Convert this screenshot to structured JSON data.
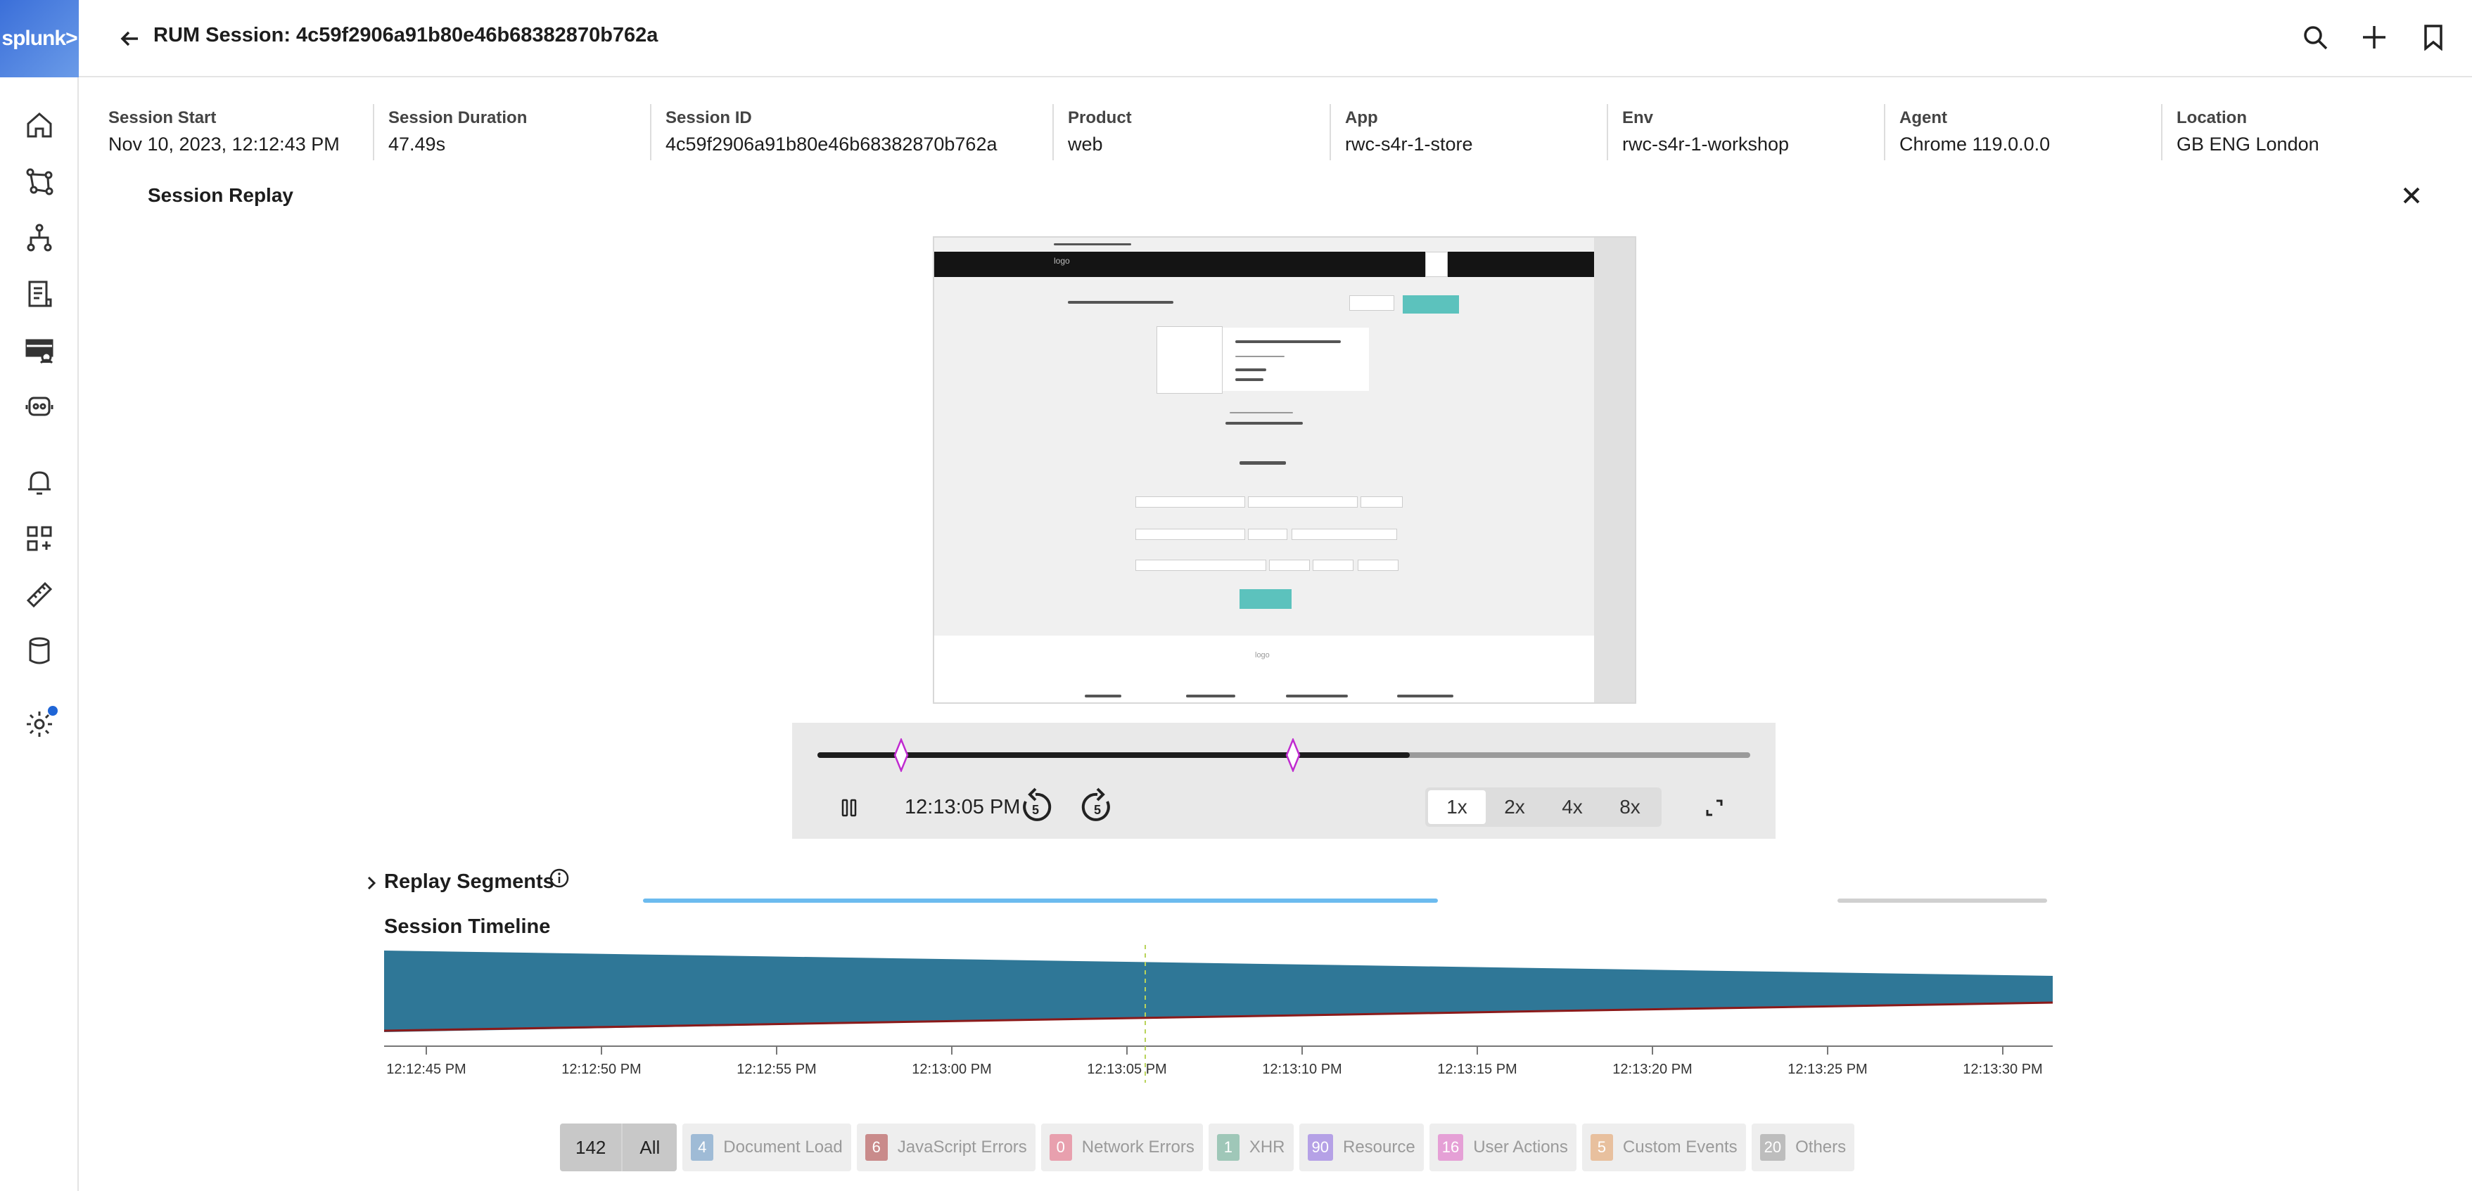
{
  "brand": {
    "logo_text": "splunk>"
  },
  "header": {
    "title": "RUM Session: 4c59f2906a91b80e46b68382870b762a"
  },
  "nav": {
    "items": [
      {
        "name": "home-icon"
      },
      {
        "name": "service-map-icon"
      },
      {
        "name": "apm-icon"
      },
      {
        "name": "logs-icon"
      },
      {
        "name": "rum-icon"
      },
      {
        "name": "synthetics-icon"
      },
      {
        "name": "alerts-icon"
      },
      {
        "name": "dashboards-icon"
      },
      {
        "name": "metrics-ruler-icon"
      },
      {
        "name": "data-icon"
      },
      {
        "name": "settings-icon"
      }
    ]
  },
  "meta": [
    {
      "label": "Session Start",
      "value": "Nov 10, 2023, 12:12:43 PM"
    },
    {
      "label": "Session Duration",
      "value": "47.49s"
    },
    {
      "label": "Session ID",
      "value": "4c59f2906a91b80e46b68382870b762a"
    },
    {
      "label": "Product",
      "value": "web"
    },
    {
      "label": "App",
      "value": "rwc-s4r-1-store"
    },
    {
      "label": "Env",
      "value": "rwc-s4r-1-workshop"
    },
    {
      "label": "Agent",
      "value": "Chrome 119.0.0.0"
    },
    {
      "label": "Location",
      "value": "GB ENG London"
    }
  ],
  "replay": {
    "title": "Session Replay",
    "current_time": "12:13:05 PM",
    "progress": 0.635,
    "marker_positions": [
      0.09,
      0.51
    ],
    "skip_back": "5",
    "skip_forward": "5",
    "speeds": [
      "1x",
      "2x",
      "4x",
      "8x"
    ],
    "selected_speed": "1x",
    "preview": {
      "logo_alt": "logo",
      "footer_logo_alt": "logo"
    }
  },
  "segments": {
    "label": "Replay Segments"
  },
  "timeline": {
    "label": "Session Timeline",
    "ticks": [
      "12:12:45 PM",
      "12:12:50 PM",
      "12:12:55 PM",
      "12:13:00 PM",
      "12:13:05 PM",
      "12:13:10 PM",
      "12:13:15 PM",
      "12:13:20 PM",
      "12:13:25 PM",
      "12:13:30 PM"
    ],
    "current": "12:13:05 PM",
    "colors": {
      "area": "#2f7797",
      "line": "#8b1a1a",
      "cursor": "#b9d35a"
    }
  },
  "filters": {
    "all": {
      "count": "142",
      "label": "All"
    },
    "chips": [
      {
        "count": "4",
        "label": "Document Load",
        "color": "#9fbbd6"
      },
      {
        "count": "6",
        "label": "JavaScript Errors",
        "color": "#c98b8b"
      },
      {
        "count": "0",
        "label": "Network Errors",
        "color": "#e8a0ae"
      },
      {
        "count": "1",
        "label": "XHR",
        "color": "#9fc7b8"
      },
      {
        "count": "90",
        "label": "Resource",
        "color": "#b5a1e6"
      },
      {
        "count": "16",
        "label": "User Actions",
        "color": "#e5a0d6"
      },
      {
        "count": "5",
        "label": "Custom Events",
        "color": "#e8c09e"
      },
      {
        "count": "20",
        "label": "Others",
        "color": "#bdbdbd"
      }
    ]
  }
}
